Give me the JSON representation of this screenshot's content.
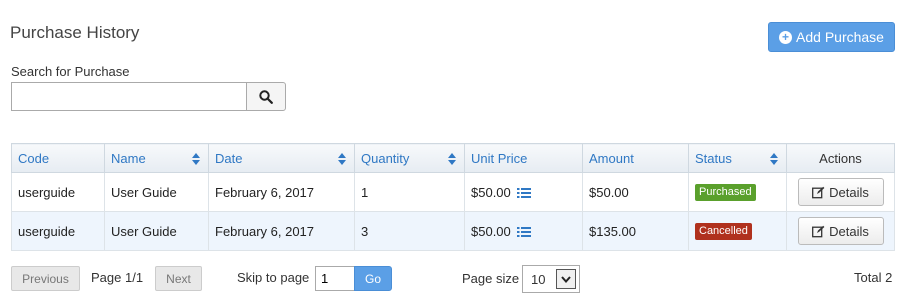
{
  "page": {
    "title": "Purchase History"
  },
  "toolbar": {
    "add_label": "Add Purchase"
  },
  "search": {
    "label": "Search for Purchase",
    "value": "",
    "placeholder": ""
  },
  "table": {
    "columns": [
      "Code",
      "Name",
      "Date",
      "Quantity",
      "Unit Price",
      "Amount",
      "Status",
      "Actions"
    ],
    "rows": [
      {
        "code": "userguide",
        "name": "User Guide",
        "date": "February 6, 2017",
        "quantity": "1",
        "unit_price": "$50.00",
        "amount": "$50.00",
        "status": "Purchased",
        "action": "Details"
      },
      {
        "code": "userguide",
        "name": "User Guide",
        "date": "February 6, 2017",
        "quantity": "3",
        "unit_price": "$50.00",
        "amount": "$135.00",
        "status": "Cancelled",
        "action": "Details"
      }
    ]
  },
  "pager": {
    "previous": "Previous",
    "page_info": "Page 1/1",
    "next": "Next",
    "skip_label": "Skip to page",
    "skip_value": "1",
    "go": "Go",
    "page_size_label": "Page size",
    "page_size": "10",
    "total": "Total 2"
  },
  "colors": {
    "accent": "#5b9fe6",
    "header_text": "#2f78c4",
    "purchased": "#5aa02c",
    "cancelled": "#b0311e",
    "alt_row": "#eef5fd"
  }
}
